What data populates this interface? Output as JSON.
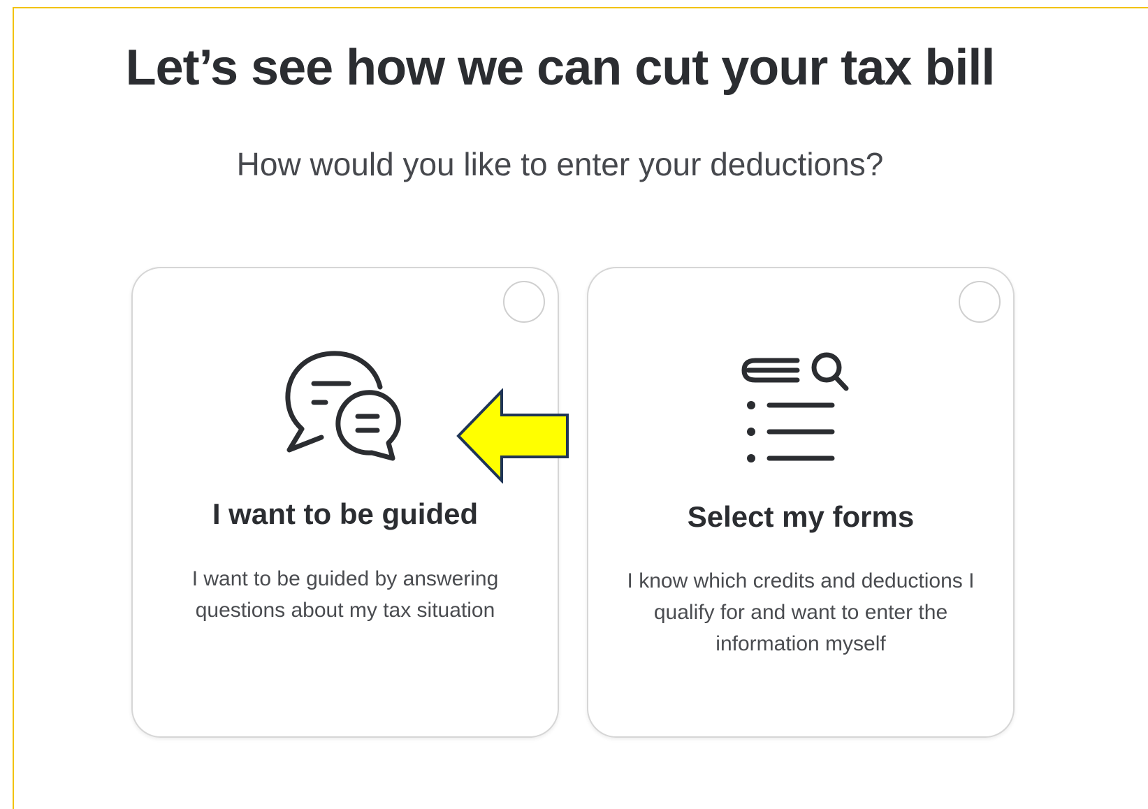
{
  "page": {
    "title": "Let’s see how we can cut your tax bill",
    "subtitle": "How would you like to enter your deductions?"
  },
  "options": [
    {
      "title": "I want to be guided",
      "description": "I want to be guided by answering questions about my tax situation",
      "icon": "chat-bubbles-icon",
      "selected": false
    },
    {
      "title": "Select my forms",
      "description": "I know which credits and deductions I qualify for and want to enter the information myself",
      "icon": "list-search-icon",
      "selected": false
    }
  ],
  "annotation": {
    "icon": "left-arrow-icon",
    "fill_color": "#ffff00",
    "stroke_color": "#1f3556"
  },
  "colors": {
    "frame_border": "#f2c200",
    "text_primary": "#2b2d31",
    "card_border": "#d6d6d6"
  }
}
